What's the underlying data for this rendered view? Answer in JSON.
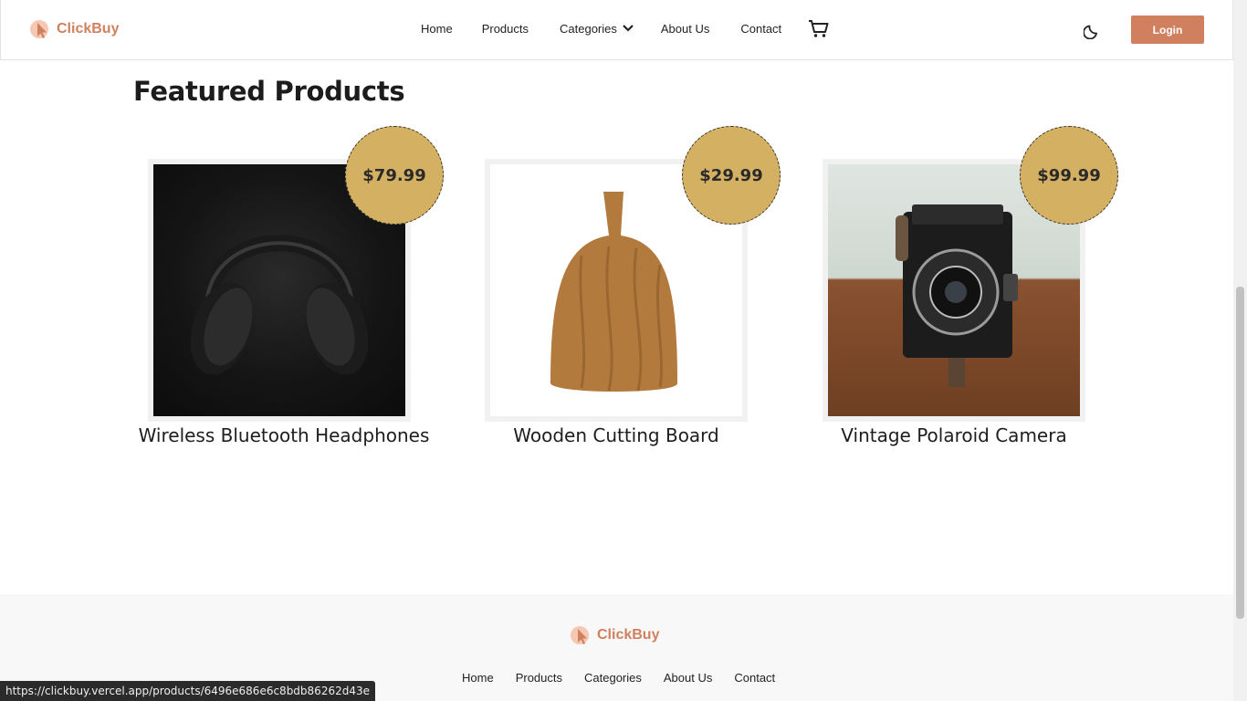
{
  "header": {
    "brand": "ClickBuy",
    "nav": {
      "home": "Home",
      "products": "Products",
      "categories": "Categories",
      "about": "About Us",
      "contact": "Contact"
    },
    "login_label": "Login"
  },
  "main": {
    "section_title": "Featured Products",
    "products": [
      {
        "name": "Wireless Bluetooth Headphones",
        "price": "$79.99"
      },
      {
        "name": "Wooden Cutting Board",
        "price": "$29.99"
      },
      {
        "name": "Vintage Polaroid Camera",
        "price": "$99.99"
      }
    ]
  },
  "footer": {
    "brand": "ClickBuy",
    "links": [
      "Home",
      "Products",
      "Categories",
      "About Us",
      "Contact"
    ]
  },
  "status_bar": {
    "url": "https://clickbuy.vercel.app/products/6496e686e6c8bdb86262d43e"
  },
  "colors": {
    "accent": "#d0805f",
    "price_badge": "#d4b062",
    "footer_bg": "#f8f8f8"
  }
}
